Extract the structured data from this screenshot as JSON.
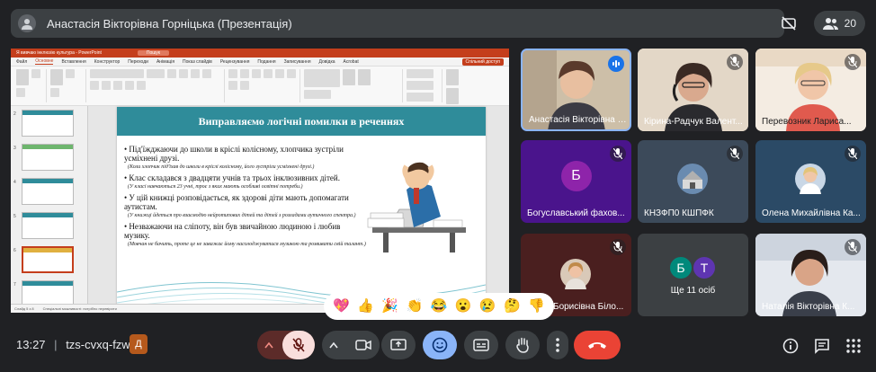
{
  "header": {
    "presenter_title": "Анастасія Вікторівна Горніцька (Презентація)",
    "participant_count": "20"
  },
  "presentation": {
    "window_title": "Я вивчаю інклюзію культура - PowerPoint",
    "search_placeholder": "Пошук",
    "tabs": [
      "Файл",
      "Основне",
      "Вставлення",
      "Конструктор",
      "Переходи",
      "Анімація",
      "Показ слайдів",
      "Рецензування",
      "Подання",
      "Записування",
      "Довідка",
      "Acrobat"
    ],
    "share_label": "Спільний доступ",
    "status_left": "Слайд 5 з 8",
    "status_mid": "Спеціальні можливості: потрібно перевірити",
    "thumb_numbers": [
      "2",
      "3",
      "4",
      "5",
      "6",
      "7"
    ],
    "slide": {
      "title": "Виправляємо логічні помилки в реченнях",
      "items": [
        {
          "bullet": "Під'їжджаючи до школи в кріслі колісному, хлопчика зустріли усміхнені друзі.",
          "note": "(Коли хлопчик під'їхав до школи в кріслі колісному, його зустріли усміхнені друзі.)"
        },
        {
          "bullet": "Клас складався з двадцяти учнів та трьох інклюзивних дітей.",
          "note": "(У класі навчаються 23 учні, троє з яких мають особливі освітні потреби.)"
        },
        {
          "bullet": "У цій книжці розповідається, як здорові діти мають допомагати аутистам.",
          "note": "(У книжці йдеться про взаємодію нейротипових дітей та дітей з розладами аутичного спектра.)"
        },
        {
          "bullet": "Незважаючи на сліпоту, він був звичайною людиною і любив музику.",
          "note": "(Мовчан не бачить, проте це не заважає йому насолоджуватися музикою та розвивати свій талант.)"
        }
      ]
    }
  },
  "participants": [
    {
      "name": "Анастасія Вікторівна Г...",
      "kind": "video",
      "speaking": true
    },
    {
      "name": "Кірина-Радчук Валент...",
      "kind": "video",
      "muted": true
    },
    {
      "name": "Перевозник Лариса...",
      "kind": "video",
      "muted": true
    },
    {
      "name": "Богуславський фахов...",
      "kind": "avatar",
      "letter": "Б",
      "color": "#8e24aa",
      "muted": true
    },
    {
      "name": "КНЗФП0 КШПФК",
      "kind": "photo",
      "muted": true
    },
    {
      "name": "Олена Михайлівна Ка...",
      "kind": "photo",
      "muted": true
    },
    {
      "name": "Борисівна Біло...",
      "kind": "photo",
      "muted": true
    },
    {
      "name": "Ще 11 осіб",
      "kind": "group",
      "letters": [
        "Б",
        "Т"
      ],
      "colors": [
        "#00897b",
        "#5e35b1"
      ]
    },
    {
      "name": "Наталія Вікторівна К...",
      "kind": "video",
      "muted": true
    }
  ],
  "reactions": [
    "💖",
    "👍",
    "🎉",
    "👏",
    "😂",
    "😮",
    "😢",
    "🤔",
    "👎"
  ],
  "bottom": {
    "time": "13:27",
    "separator": "|",
    "meeting_code": "tzs-cvxq-fzw",
    "code_badge": "Д"
  },
  "colors": {
    "accent_blue": "#8ab4f8",
    "end_call": "#ea4335",
    "mic_muted_bg": "#f9dedc",
    "ppt_red": "#c43e1c",
    "slide_teal": "#2f8c9a"
  }
}
